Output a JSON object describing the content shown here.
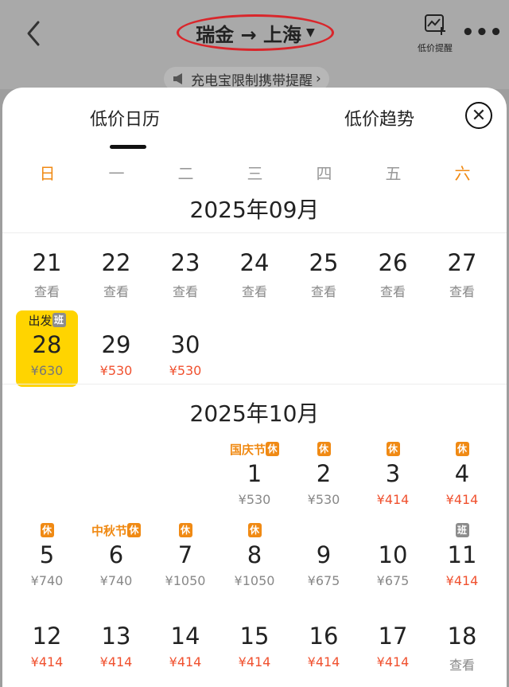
{
  "header": {
    "route": "瑞金 → 上海",
    "low_price_alert_label": "低价提醒",
    "notice": "充电宝限制携带提醒"
  },
  "tabs": [
    "低价日历",
    "低价趋势"
  ],
  "weekdays": [
    "日",
    "一",
    "二",
    "三",
    "四",
    "五",
    "六"
  ],
  "accent_colors": {
    "weekend": "#f08a14",
    "price_red": "#f0512f",
    "selected": "#ffd400"
  },
  "months": [
    {
      "title": "2025年09月",
      "rows": [
        [
          {
            "day": "21",
            "sub": "查看"
          },
          {
            "day": "22",
            "sub": "查看"
          },
          {
            "day": "23",
            "sub": "查看"
          },
          {
            "day": "24",
            "sub": "查看"
          },
          {
            "day": "25",
            "sub": "查看"
          },
          {
            "day": "26",
            "sub": "查看"
          },
          {
            "day": "27",
            "sub": "查看"
          }
        ],
        [
          {
            "day": "28",
            "sub": "¥630",
            "tag": "出发",
            "badge": "班",
            "selected": true
          },
          {
            "day": "29",
            "sub": "¥530",
            "red": true
          },
          {
            "day": "30",
            "sub": "¥530",
            "red": true
          }
        ]
      ]
    },
    {
      "title": "2025年10月",
      "rows": [
        [
          null,
          null,
          null,
          {
            "day": "1",
            "sub": "¥530",
            "tag": "国庆节",
            "badge": "休"
          },
          {
            "day": "2",
            "sub": "¥530",
            "badge": "休"
          },
          {
            "day": "3",
            "sub": "¥414",
            "badge": "休",
            "red": true
          },
          {
            "day": "4",
            "sub": "¥414",
            "badge": "休",
            "red": true
          }
        ],
        [
          {
            "day": "5",
            "sub": "¥740",
            "badge": "休"
          },
          {
            "day": "6",
            "sub": "¥740",
            "tag": "中秋节",
            "badge": "休"
          },
          {
            "day": "7",
            "sub": "¥1050",
            "badge": "休"
          },
          {
            "day": "8",
            "sub": "¥1050",
            "badge": "休"
          },
          {
            "day": "9",
            "sub": "¥675"
          },
          {
            "day": "10",
            "sub": "¥675"
          },
          {
            "day": "11",
            "sub": "¥414",
            "badge": "班",
            "red": true
          }
        ],
        [
          {
            "day": "12",
            "sub": "¥414",
            "red": true
          },
          {
            "day": "13",
            "sub": "¥414",
            "red": true
          },
          {
            "day": "14",
            "sub": "¥414",
            "red": true
          },
          {
            "day": "15",
            "sub": "¥414",
            "red": true
          },
          {
            "day": "16",
            "sub": "¥414",
            "red": true
          },
          {
            "day": "17",
            "sub": "¥414",
            "red": true
          },
          {
            "day": "18",
            "sub": "查看"
          }
        ]
      ]
    }
  ]
}
